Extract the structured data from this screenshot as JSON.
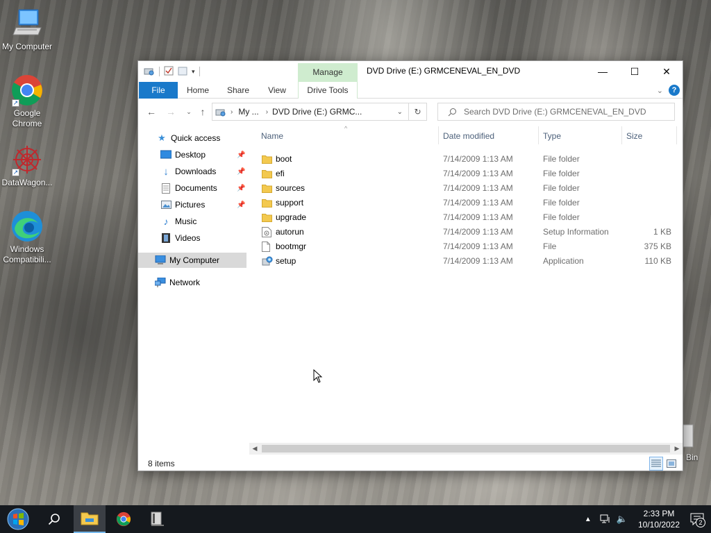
{
  "desktop": {
    "icons": [
      {
        "label": "My Computer"
      },
      {
        "label": "Google Chrome"
      },
      {
        "label": "DataWagon..."
      },
      {
        "label": "Windows Compatibili..."
      }
    ],
    "recycle_bin_partial_label": "Bin"
  },
  "window": {
    "manage_tab": "Manage",
    "title": "DVD Drive (E:) GRMCENEVAL_EN_DVD",
    "caption": {
      "minimize": "—",
      "maximize": "☐",
      "close": "✕"
    },
    "ribbon_tabs": {
      "file": "File",
      "home": "Home",
      "share": "Share",
      "view": "View",
      "drive_tools": "Drive Tools"
    },
    "address": {
      "crumb1": "My ...",
      "crumb2": "DVD Drive (E:) GRMC..."
    },
    "search_placeholder": "Search DVD Drive (E:) GRMCENEVAL_EN_DVD",
    "nav": {
      "quick_access": "Quick access",
      "desktop": "Desktop",
      "downloads": "Downloads",
      "documents": "Documents",
      "pictures": "Pictures",
      "music": "Music",
      "videos": "Videos",
      "my_computer": "My Computer",
      "network": "Network"
    },
    "columns": {
      "name": "Name",
      "date": "Date modified",
      "type": "Type",
      "size": "Size"
    },
    "files": [
      {
        "name": "boot",
        "date": "7/14/2009 1:13 AM",
        "type": "File folder",
        "size": "",
        "icon": "folder-icon"
      },
      {
        "name": "efi",
        "date": "7/14/2009 1:13 AM",
        "type": "File folder",
        "size": "",
        "icon": "folder-icon"
      },
      {
        "name": "sources",
        "date": "7/14/2009 1:13 AM",
        "type": "File folder",
        "size": "",
        "icon": "folder-icon"
      },
      {
        "name": "support",
        "date": "7/14/2009 1:13 AM",
        "type": "File folder",
        "size": "",
        "icon": "folder-icon"
      },
      {
        "name": "upgrade",
        "date": "7/14/2009 1:13 AM",
        "type": "File folder",
        "size": "",
        "icon": "folder-icon"
      },
      {
        "name": "autorun",
        "date": "7/14/2009 1:13 AM",
        "type": "Setup Information",
        "size": "1 KB",
        "icon": "setup-info-icon"
      },
      {
        "name": "bootmgr",
        "date": "7/14/2009 1:13 AM",
        "type": "File",
        "size": "375 KB",
        "icon": "file-icon"
      },
      {
        "name": "setup",
        "date": "7/14/2009 1:13 AM",
        "type": "Application",
        "size": "110 KB",
        "icon": "setup-app-icon"
      }
    ],
    "status": "8 items"
  },
  "taskbar": {
    "time": "2:33 PM",
    "date": "10/10/2022",
    "notification_count": "2"
  },
  "colors": {
    "accent": "#1979ca",
    "manage_tab": "#cfeccf",
    "folder": "#f3c94f",
    "taskbar": "#15191e"
  }
}
